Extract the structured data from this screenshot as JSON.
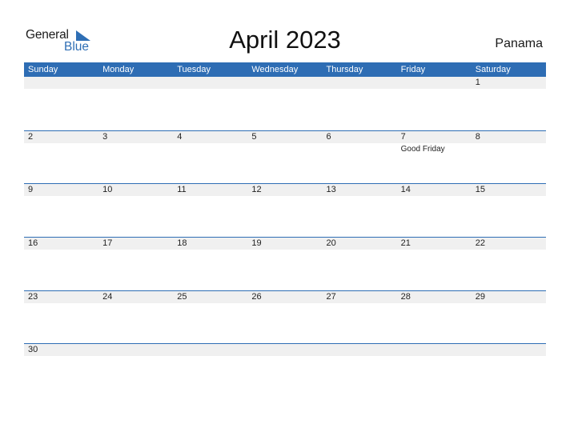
{
  "logo": {
    "line1": "General",
    "line2": "Blue"
  },
  "title": "April 2023",
  "country": "Panama",
  "colors": {
    "accent": "#2e6db4",
    "strip": "#f0f0f0"
  },
  "weekdays": [
    "Sunday",
    "Monday",
    "Tuesday",
    "Wednesday",
    "Thursday",
    "Friday",
    "Saturday"
  ],
  "weeks": [
    [
      {
        "d": ""
      },
      {
        "d": ""
      },
      {
        "d": ""
      },
      {
        "d": ""
      },
      {
        "d": ""
      },
      {
        "d": ""
      },
      {
        "d": "1"
      }
    ],
    [
      {
        "d": "2"
      },
      {
        "d": "3"
      },
      {
        "d": "4"
      },
      {
        "d": "5"
      },
      {
        "d": "6"
      },
      {
        "d": "7",
        "event": "Good Friday"
      },
      {
        "d": "8"
      }
    ],
    [
      {
        "d": "9"
      },
      {
        "d": "10"
      },
      {
        "d": "11"
      },
      {
        "d": "12"
      },
      {
        "d": "13"
      },
      {
        "d": "14"
      },
      {
        "d": "15"
      }
    ],
    [
      {
        "d": "16"
      },
      {
        "d": "17"
      },
      {
        "d": "18"
      },
      {
        "d": "19"
      },
      {
        "d": "20"
      },
      {
        "d": "21"
      },
      {
        "d": "22"
      }
    ],
    [
      {
        "d": "23"
      },
      {
        "d": "24"
      },
      {
        "d": "25"
      },
      {
        "d": "26"
      },
      {
        "d": "27"
      },
      {
        "d": "28"
      },
      {
        "d": "29"
      }
    ],
    [
      {
        "d": "30"
      },
      {
        "d": ""
      },
      {
        "d": ""
      },
      {
        "d": ""
      },
      {
        "d": ""
      },
      {
        "d": ""
      },
      {
        "d": ""
      }
    ]
  ]
}
